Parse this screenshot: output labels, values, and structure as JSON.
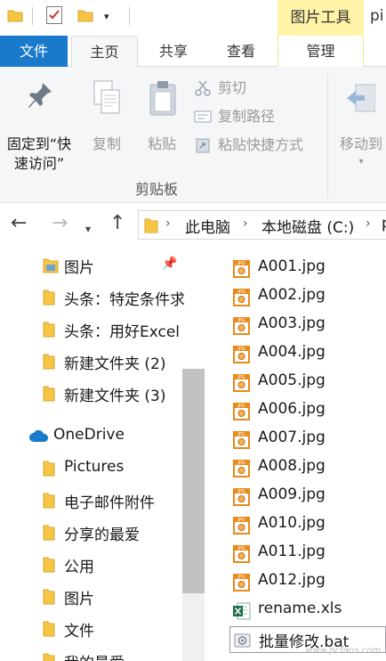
{
  "title_bar": {
    "contextual_tab_group": "图片工具",
    "window_title": "pi"
  },
  "tabs": {
    "file": "文件",
    "home": "主页",
    "share": "共享",
    "view": "查看",
    "manage": "管理"
  },
  "ribbon": {
    "pin_quick_access": [
      "固定到“快",
      "速访问”"
    ],
    "copy": "复制",
    "paste": "粘贴",
    "cut": "剪切",
    "copy_path": "复制路径",
    "paste_shortcut": "粘贴快捷方式",
    "move_to": "移动到",
    "group_label": "剪贴板"
  },
  "address": {
    "crumbs": [
      "此电脑",
      "本地磁盘 (C:)",
      "pi"
    ]
  },
  "nav_pane": {
    "quick_access": [
      {
        "label": "图片",
        "icon": "pictures-folder-icon",
        "pinned": true
      },
      {
        "label": "头条：特定条件求",
        "icon": "folder-icon"
      },
      {
        "label": "头条：用好Excel",
        "icon": "folder-icon"
      },
      {
        "label": "新建文件夹 (2)",
        "icon": "folder-icon"
      },
      {
        "label": "新建文件夹 (3)",
        "icon": "folder-icon"
      }
    ],
    "onedrive": {
      "label": "OneDrive",
      "icon": "cloud-icon"
    },
    "onedrive_items": [
      {
        "label": "Pictures"
      },
      {
        "label": "电子邮件附件"
      },
      {
        "label": "分享的最爱"
      },
      {
        "label": "公用"
      },
      {
        "label": "图片"
      },
      {
        "label": "文件"
      },
      {
        "label": "我的最爱"
      }
    ]
  },
  "files": [
    {
      "name": "A001.jpg",
      "icon": "jpg-icon"
    },
    {
      "name": "A002.jpg",
      "icon": "jpg-icon"
    },
    {
      "name": "A003.jpg",
      "icon": "jpg-icon"
    },
    {
      "name": "A004.jpg",
      "icon": "jpg-icon"
    },
    {
      "name": "A005.jpg",
      "icon": "jpg-icon"
    },
    {
      "name": "A006.jpg",
      "icon": "jpg-icon"
    },
    {
      "name": "A007.jpg",
      "icon": "jpg-icon"
    },
    {
      "name": "A008.jpg",
      "icon": "jpg-icon"
    },
    {
      "name": "A009.jpg",
      "icon": "jpg-icon"
    },
    {
      "name": "A010.jpg",
      "icon": "jpg-icon"
    },
    {
      "name": "A011.jpg",
      "icon": "jpg-icon"
    },
    {
      "name": "A012.jpg",
      "icon": "jpg-icon"
    },
    {
      "name": "rename.xls",
      "icon": "excel-icon"
    },
    {
      "name": "批量修改.bat",
      "icon": "batch-file-icon"
    }
  ],
  "watermark": "www.pcfans.com",
  "colors": {
    "file_tab": "#1979ca",
    "contextual_tab": "#fff3a8",
    "folder": "#f6c544",
    "jpg_orange": "#e98a1b"
  }
}
